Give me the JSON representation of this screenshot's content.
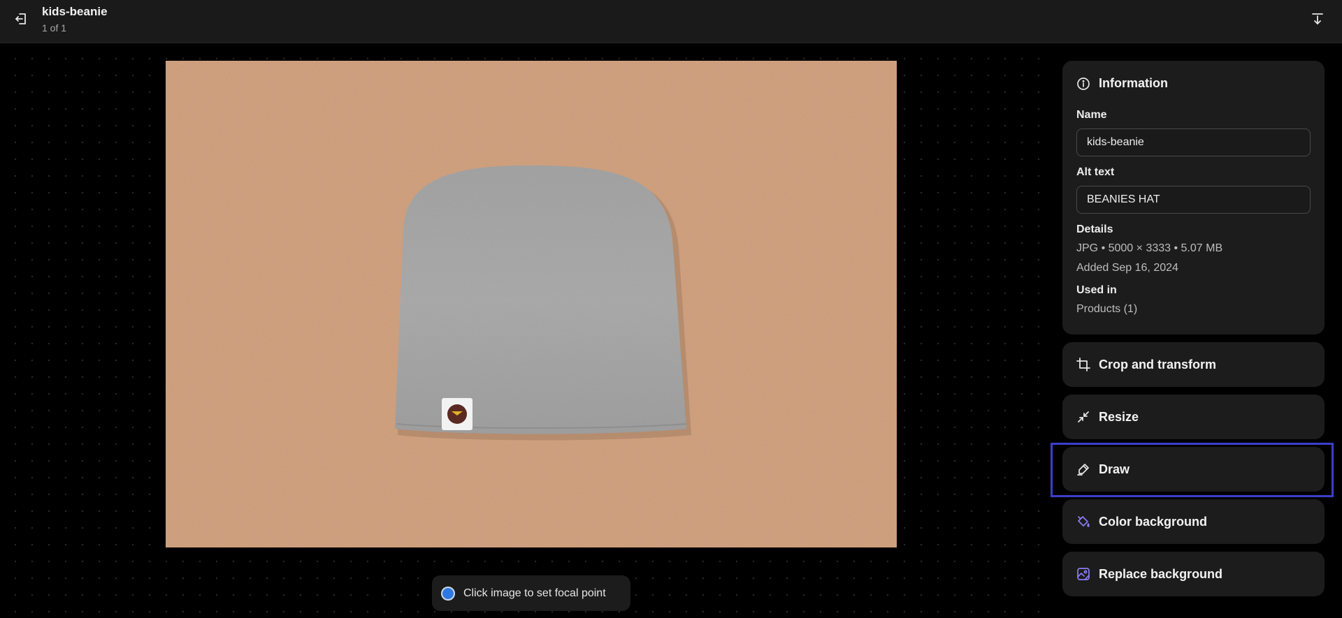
{
  "header": {
    "title": "kids-beanie",
    "pagination": "1 of 1",
    "back_icon": "exit-left-icon",
    "download_icon": "download-icon"
  },
  "viewer": {
    "image_alt": "BEANIES HAT",
    "focal_hint": "Click image to set focal point",
    "focal_color": "#2d79e0"
  },
  "info": {
    "heading": "Information",
    "name_label": "Name",
    "name_value": "kids-beanie",
    "alt_label": "Alt text",
    "alt_value": "BEANIES HAT",
    "details_label": "Details",
    "details_line1": "JPG • 5000 × 3333 • 5.07 MB",
    "details_line2": "Added Sep 16, 2024",
    "used_label": "Used in",
    "used_value": "Products (1)"
  },
  "actions": [
    {
      "label": "Crop and transform",
      "icon": "crop-icon"
    },
    {
      "label": "Resize",
      "icon": "resize-icon"
    },
    {
      "label": "Draw",
      "icon": "draw-icon"
    },
    {
      "label": "Color background",
      "icon": "paint-bucket-icon"
    },
    {
      "label": "Replace background",
      "icon": "replace-image-icon"
    }
  ],
  "colors": {
    "accent_purple": "#8b7cf6",
    "highlight": "#3b3fc9"
  }
}
